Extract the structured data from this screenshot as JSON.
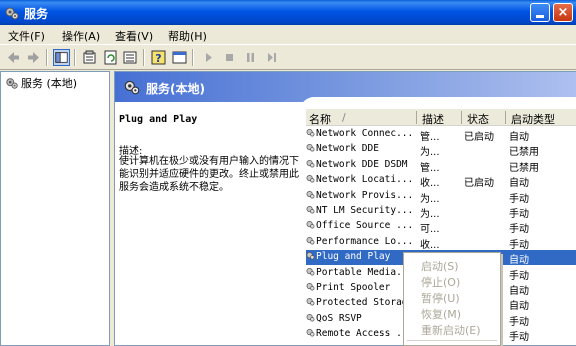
{
  "window": {
    "title": "服务"
  },
  "menu": [
    {
      "label": "文件(F)"
    },
    {
      "label": "操作(A)"
    },
    {
      "label": "查看(V)"
    },
    {
      "label": "帮助(H)"
    }
  ],
  "tree": {
    "root_label": "服务 (本地)"
  },
  "right_header": {
    "title": "服务(本地)"
  },
  "detail": {
    "service_name": "Plug and Play",
    "desc_label": "描述:",
    "desc_text": "使计算机在极少或没有用户输入的情况下能识别并适应硬件的更改。终止或禁用此服务会造成系统不稳定。"
  },
  "columns": {
    "name": "名称",
    "sort_arrow": "/",
    "description": "描述",
    "status": "状态",
    "startup": "启动类型"
  },
  "services": [
    {
      "name": "Network Connec...",
      "description": "管...",
      "status": "已启动",
      "startup": "自动"
    },
    {
      "name": "Network DDE",
      "description": "为...",
      "status": "",
      "startup": "已禁用"
    },
    {
      "name": "Network DDE DSDM",
      "description": "管...",
      "status": "",
      "startup": "已禁用"
    },
    {
      "name": "Network Locati...",
      "description": "收...",
      "status": "已启动",
      "startup": "自动"
    },
    {
      "name": "Network Provis...",
      "description": "为...",
      "status": "",
      "startup": "手动"
    },
    {
      "name": "NT LM Security...",
      "description": "为...",
      "status": "",
      "startup": "手动"
    },
    {
      "name": "Office Source ...",
      "description": "可...",
      "status": "",
      "startup": "手动"
    },
    {
      "name": "Performance Lo...",
      "description": "收...",
      "status": "",
      "startup": "手动"
    },
    {
      "name": "Plug and Play",
      "description": "",
      "status": "",
      "startup": "自动",
      "selected": true
    },
    {
      "name": "Portable Media...",
      "description": "",
      "status": "",
      "startup": "手动"
    },
    {
      "name": "Print Spooler",
      "description": "",
      "status": "",
      "startup": "自动"
    },
    {
      "name": "Protected Storag",
      "description": "",
      "status": "",
      "startup": "自动"
    },
    {
      "name": "QoS RSVP",
      "description": "",
      "status": "",
      "startup": "手动"
    },
    {
      "name": "Remote Access ...",
      "description": "",
      "status": "",
      "startup": "手动"
    }
  ],
  "context_menu": {
    "start": "启动(S)",
    "stop": "停止(O)",
    "pause": "暂停(U)",
    "resume": "恢复(M)",
    "restart": "重新启动(E)"
  },
  "colors": {
    "titlebar": "#0054e3",
    "selection": "#316ac5",
    "header_gradient": "#4670d4"
  }
}
